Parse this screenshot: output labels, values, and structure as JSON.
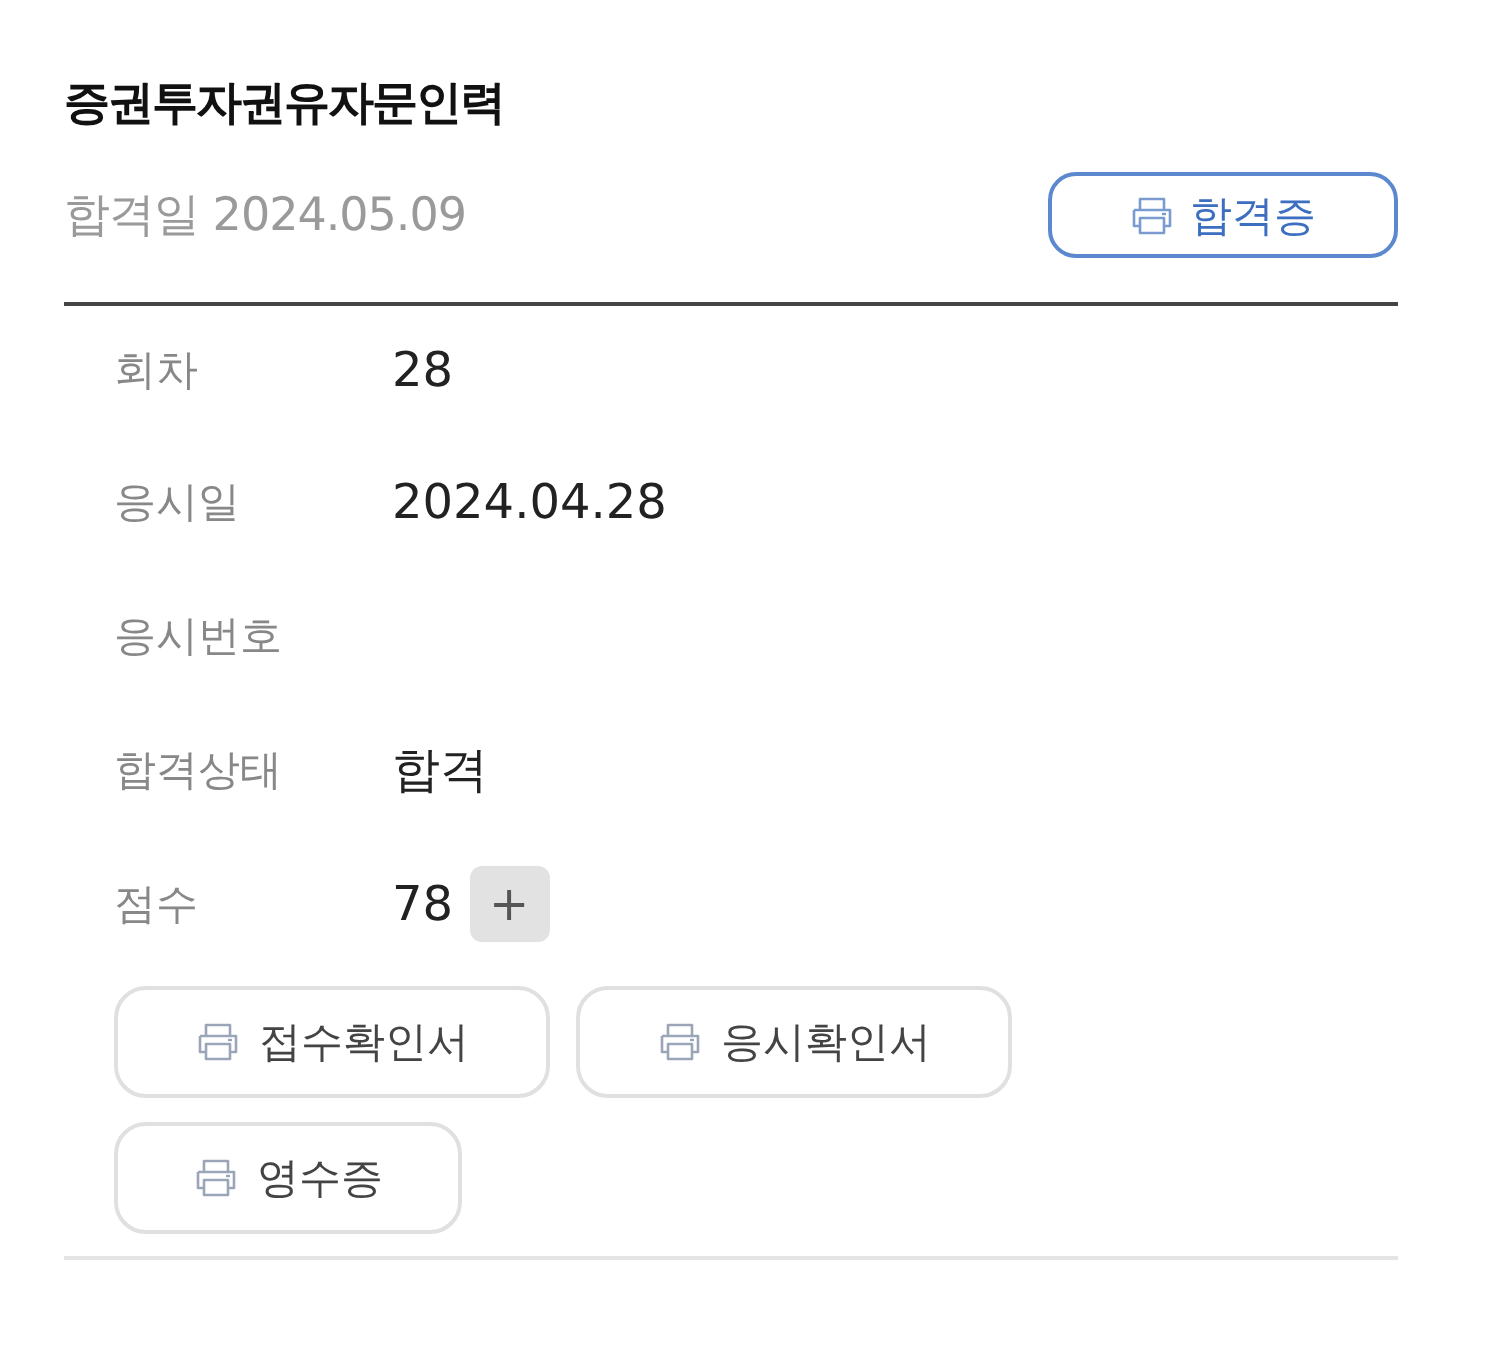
{
  "title": "증권투자권유자문인력",
  "pass_date": "합격일 2024.05.09",
  "certificate_button": "합격증",
  "rows": [
    {
      "label": "회차",
      "value": "28"
    },
    {
      "label": "응시일",
      "value": "2024.04.28"
    },
    {
      "label": "응시번호"
    },
    {
      "label": "합격상태",
      "value": "합격"
    },
    {
      "label": "점수",
      "value": "78",
      "expand_button": "+"
    }
  ],
  "print_buttons": [
    "접수확인서",
    "응시확인서",
    "영수증"
  ]
}
